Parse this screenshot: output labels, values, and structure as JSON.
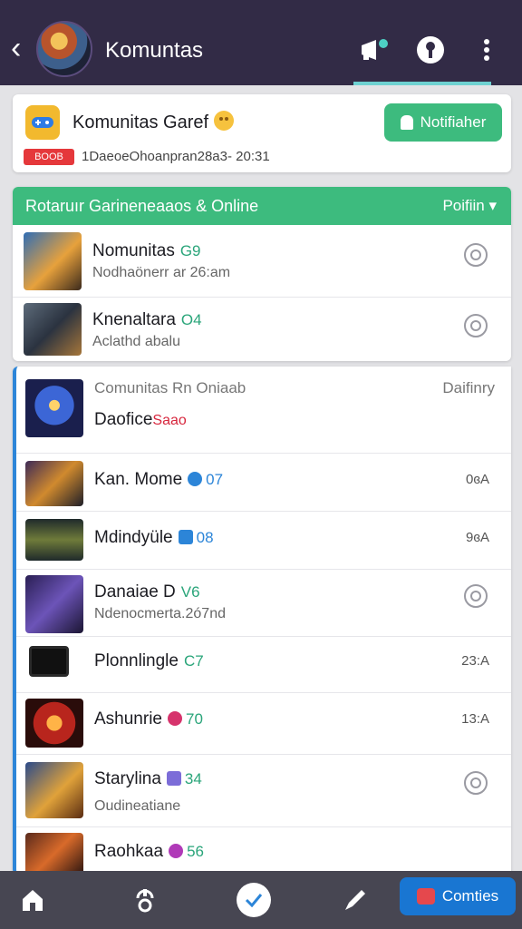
{
  "header": {
    "title": "Komuntas",
    "back_icon": "chevron-left-icon",
    "icons": [
      "megaphone-icon",
      "info-icon",
      "more-vertical-icon"
    ]
  },
  "top_card": {
    "title": "Komunitas Garef",
    "badge": "BOOB",
    "subtitle": "1DaeoeOhoanpran28a3- 20:31",
    "notify_label": "Notifiaher"
  },
  "section1": {
    "title": "Rotaruır Garineneaaos & Online",
    "filter_label": "Poifiin ▾",
    "rows": [
      {
        "name": "Nomunitas",
        "count": "G9",
        "sub": "Nodhaönerr ar 26:am"
      },
      {
        "name": "Knenaltara",
        "count": "O4",
        "sub": "Aclathd abalu"
      }
    ]
  },
  "section2": {
    "title": "Comunitas Rn Oniaab",
    "right_label": "Daifinry",
    "featured": {
      "name": "Daofice",
      "tag": "Saao"
    },
    "rows": [
      {
        "name": "Kan. Mome",
        "count": "07",
        "time": "0ɞA"
      },
      {
        "name": "Mdindyüle",
        "count": "08",
        "time": "9ɞA"
      },
      {
        "name": "Danaiae D",
        "count": "V6",
        "sub": "Ndenocmerta.2ó7nd"
      },
      {
        "name": "Plonnlingle",
        "count": "C7",
        "time": "23:A"
      },
      {
        "name": "Ashunrie",
        "count": "70",
        "time": "13:A"
      },
      {
        "name": "Starylina",
        "count": "34",
        "sub": "Oudineatiane"
      },
      {
        "name": "Raohkaa",
        "count": "56"
      }
    ]
  },
  "bottom_nav": {
    "community_label": "Comties",
    "icons": [
      "home-icon",
      "headset-icon",
      "check-icon",
      "pen-icon"
    ]
  },
  "colors": {
    "header": "#322b46",
    "accent_green": "#3dbb7e",
    "accent_blue": "#1976d2",
    "badge_red": "#e5383b"
  }
}
